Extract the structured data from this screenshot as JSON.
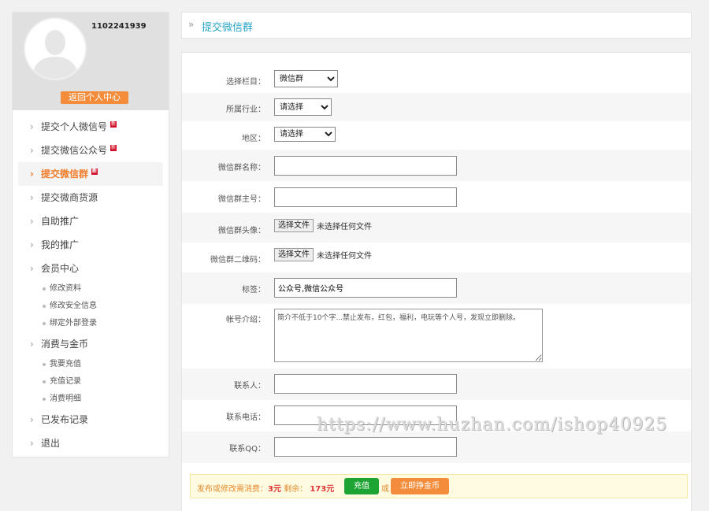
{
  "profile": {
    "username": "1102241939",
    "back_button": "返回个人中心"
  },
  "sidebar": {
    "items": [
      {
        "label": "提交个人微信号",
        "badge": "新",
        "active": false
      },
      {
        "label": "提交微信公众号",
        "badge": "新",
        "active": false
      },
      {
        "label": "提交微信群",
        "badge": "新",
        "active": true
      },
      {
        "label": "提交微商货源",
        "active": false
      },
      {
        "label": "自助推广",
        "active": false
      },
      {
        "label": "我的推广",
        "active": false
      },
      {
        "label": "会员中心",
        "active": false,
        "children": [
          "修改资料",
          "修改安全信息",
          "绑定外部登录"
        ]
      },
      {
        "label": "消费与金币",
        "active": false,
        "children": [
          "我要充值",
          "充值记录",
          "消费明细"
        ]
      },
      {
        "label": "已发布记录",
        "active": false
      },
      {
        "label": "退出",
        "active": false
      }
    ]
  },
  "header": {
    "chevron": "»",
    "title": "提交微信群"
  },
  "form": {
    "category": {
      "label": "选择栏目：",
      "value": "微信群"
    },
    "industry": {
      "label": "所属行业：",
      "value": "请选择"
    },
    "region": {
      "label": "地区：",
      "value": "请选择"
    },
    "group_name": {
      "label": "微信群名称：",
      "value": ""
    },
    "group_owner": {
      "label": "微信群主号：",
      "value": ""
    },
    "avatar": {
      "label": "微信群头像：",
      "button": "选择文件",
      "status": "未选择任何文件"
    },
    "qrcode": {
      "label": "微信群二维码：",
      "button": "选择文件",
      "status": "未选择任何文件"
    },
    "tags": {
      "label": "标签：",
      "value": "公众号,微信公众号"
    },
    "intro": {
      "label": "帐号介绍：",
      "value": "简介不低于10个字...禁止发布，红包，福利，电玩等个人号，发现立即删除。"
    },
    "contact": {
      "label": "联系人：",
      "value": ""
    },
    "phone": {
      "label": "联系电话：",
      "value": ""
    },
    "qq": {
      "label": "联系QQ：",
      "value": ""
    }
  },
  "fee": {
    "prefix": "发布或修改需消费：",
    "cost": "3元",
    "balance_label": " 剩余：",
    "balance": "173元",
    "recharge_button": "充值",
    "or": "或",
    "earn_button": "立即挣金币"
  },
  "watermark": "https://www.huzhan.com/ishop40925",
  "colors": {
    "accent": "#f38d3b",
    "link": "#2aa6c9",
    "success": "#1ea433"
  }
}
